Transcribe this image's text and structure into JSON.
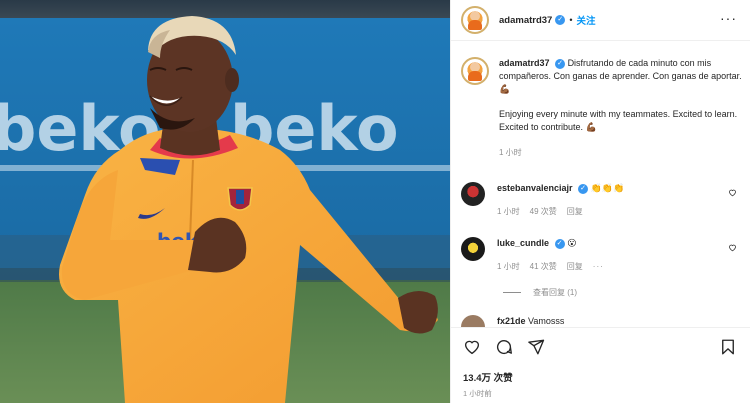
{
  "post": {
    "username": "adamatrd37",
    "follow_label": "关注",
    "separator": "•",
    "more_label": "···"
  },
  "caption": {
    "username": "adamatrd37",
    "text_es": "Disfrutando de cada minuto con mis compañeros. Con ganas de aprender. Con ganas de aportar.",
    "emoji_es": "💪🏾",
    "text_en": "Enjoying every minute with my teammates. Excited to learn. Excited to contribute.",
    "emoji_en": "💪🏾",
    "time": "1 小时"
  },
  "comments": [
    {
      "username": "estebanvalenciajr",
      "text": "👏👏👏",
      "time": "1 小时",
      "likes": "49 次赞",
      "reply": "回复"
    },
    {
      "username": "luke_cundle",
      "text": "😮",
      "time": "1 小时",
      "likes": "41 次赞",
      "reply": "回复",
      "more": "···"
    }
  ],
  "view_replies": "查看回复 (1)",
  "partial_comment": {
    "username": "fx21de",
    "text": "Vamosss"
  },
  "likes_count": "13.4万 次赞",
  "time_ago": "1 小时前",
  "photo": {
    "sponsor_text": "beko",
    "shirt_text": "beko"
  },
  "colors": {
    "accent": "#0095f6",
    "verified": "#3897f0",
    "jersey": "#f7a43a",
    "banner": "#1d6fa8"
  }
}
